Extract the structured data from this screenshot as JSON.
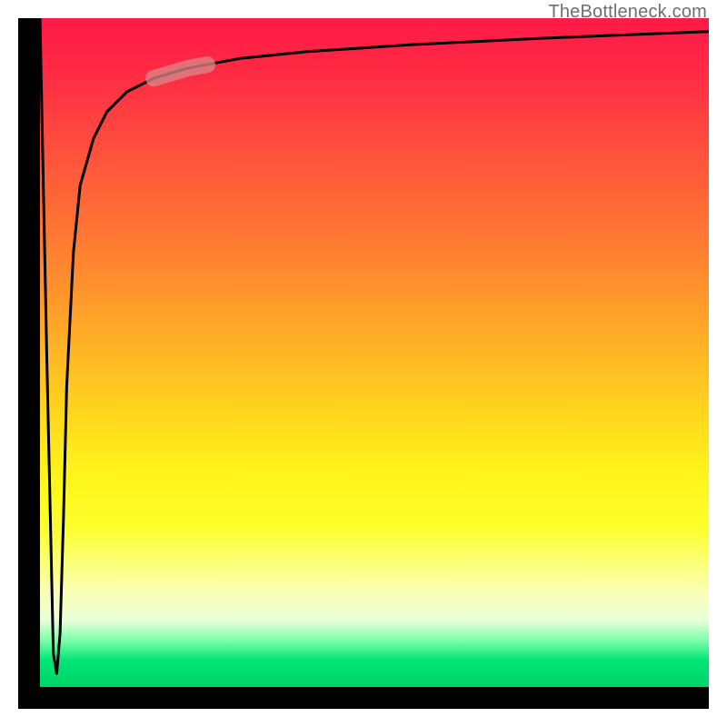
{
  "watermark": {
    "text": "TheBottleneck.com"
  },
  "chart_data": {
    "type": "line",
    "title": "",
    "xlabel": "",
    "ylabel": "",
    "xlim": [
      0,
      1
    ],
    "ylim": [
      0,
      1
    ],
    "grid": false,
    "legend": false,
    "background_gradient_stops": [
      {
        "pos": 0.0,
        "color": "#ff1a47"
      },
      {
        "pos": 0.3,
        "color": "#ff7a32"
      },
      {
        "pos": 0.55,
        "color": "#ffd21e"
      },
      {
        "pos": 0.75,
        "color": "#fdff2a"
      },
      {
        "pos": 0.9,
        "color": "#e9ffd8"
      },
      {
        "pos": 1.0,
        "color": "#00d268"
      }
    ],
    "series": [
      {
        "name": "curve",
        "note": "Line starts at top-left, dips nearly to bottom, then rises steeply back to near top and levels off toward upper-right. Y is normalized with 0 = bottom, 1 = top.",
        "x": [
          0.0,
          0.01,
          0.02,
          0.025,
          0.03,
          0.035,
          0.04,
          0.05,
          0.06,
          0.08,
          0.1,
          0.13,
          0.17,
          0.22,
          0.3,
          0.4,
          0.55,
          0.75,
          1.0
        ],
        "y": [
          1.0,
          0.5,
          0.05,
          0.02,
          0.08,
          0.25,
          0.45,
          0.65,
          0.75,
          0.82,
          0.86,
          0.89,
          0.91,
          0.925,
          0.94,
          0.95,
          0.96,
          0.97,
          0.98
        ]
      }
    ],
    "highlight_segment": {
      "note": "Pale rounded overlay on the curve around x ≈ 0.17–0.25 in the upper-left area",
      "x_start": 0.17,
      "x_end": 0.25,
      "color": "#d98a8a",
      "opacity": 0.75
    }
  }
}
